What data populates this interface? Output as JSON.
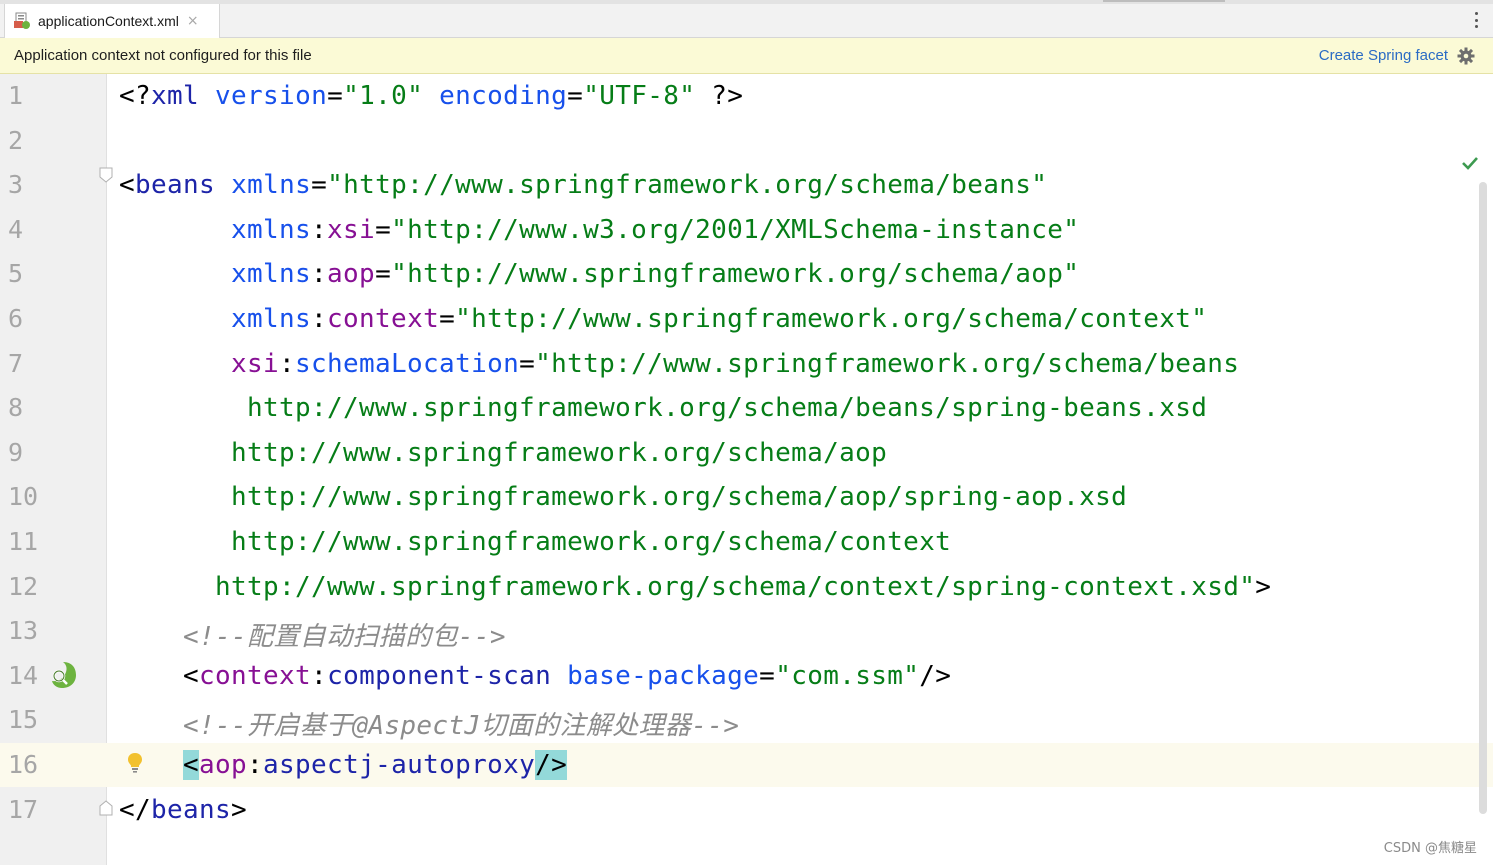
{
  "tab": {
    "label": "applicationContext.xml",
    "close": "×"
  },
  "banner": {
    "message": "Application context not configured for this file",
    "action": "Create Spring facet"
  },
  "lines": [
    {
      "number": "1",
      "indent": 0,
      "tokens": [
        {
          "t": "<?",
          "c": "punct"
        },
        {
          "t": "xml",
          "c": "tagname"
        },
        {
          "t": " ",
          "c": "punct"
        },
        {
          "t": "version",
          "c": "attr"
        },
        {
          "t": "=",
          "c": "punct"
        },
        {
          "t": "\"1.0\"",
          "c": "str"
        },
        {
          "t": " ",
          "c": "punct"
        },
        {
          "t": "encoding",
          "c": "attr"
        },
        {
          "t": "=",
          "c": "punct"
        },
        {
          "t": "\"UTF-8\"",
          "c": "str"
        },
        {
          "t": " ?>",
          "c": "punct"
        }
      ]
    },
    {
      "number": "2",
      "indent": 0,
      "tokens": []
    },
    {
      "number": "3",
      "indent": 0,
      "tokens": [
        {
          "t": "<",
          "c": "punct"
        },
        {
          "t": "beans",
          "c": "tagname"
        },
        {
          "t": " ",
          "c": "punct"
        },
        {
          "t": "xmlns",
          "c": "attr"
        },
        {
          "t": "=",
          "c": "punct"
        },
        {
          "t": "\"http://www.springframework.org/schema/beans\"",
          "c": "str"
        }
      ]
    },
    {
      "number": "4",
      "indent": 7,
      "tokens": [
        {
          "t": "xmlns",
          "c": "attr"
        },
        {
          "t": ":",
          "c": "punct"
        },
        {
          "t": "xsi",
          "c": "ns"
        },
        {
          "t": "=",
          "c": "punct"
        },
        {
          "t": "\"http://www.w3.org/2001/XMLSchema-instance\"",
          "c": "str"
        }
      ]
    },
    {
      "number": "5",
      "indent": 7,
      "tokens": [
        {
          "t": "xmlns",
          "c": "attr"
        },
        {
          "t": ":",
          "c": "punct"
        },
        {
          "t": "aop",
          "c": "ns"
        },
        {
          "t": "=",
          "c": "punct"
        },
        {
          "t": "\"http://www.springframework.org/schema/aop\"",
          "c": "str"
        }
      ]
    },
    {
      "number": "6",
      "indent": 7,
      "tokens": [
        {
          "t": "xmlns",
          "c": "attr"
        },
        {
          "t": ":",
          "c": "punct"
        },
        {
          "t": "context",
          "c": "ns"
        },
        {
          "t": "=",
          "c": "punct"
        },
        {
          "t": "\"http://www.springframework.org/schema/context\"",
          "c": "str"
        }
      ]
    },
    {
      "number": "7",
      "indent": 7,
      "tokens": [
        {
          "t": "xsi",
          "c": "ns"
        },
        {
          "t": ":",
          "c": "punct"
        },
        {
          "t": "schemaLocation",
          "c": "attr"
        },
        {
          "t": "=",
          "c": "punct"
        },
        {
          "t": "\"http://www.springframework.org/schema/beans",
          "c": "str"
        }
      ]
    },
    {
      "number": "8",
      "indent": 8,
      "tokens": [
        {
          "t": "http://www.springframework.org/schema/beans/spring-beans.xsd",
          "c": "str"
        }
      ]
    },
    {
      "number": "9",
      "indent": 7,
      "tokens": [
        {
          "t": "http://www.springframework.org/schema/aop",
          "c": "str"
        }
      ]
    },
    {
      "number": "10",
      "indent": 7,
      "tokens": [
        {
          "t": "http://www.springframework.org/schema/aop/spring-aop.xsd",
          "c": "str"
        }
      ]
    },
    {
      "number": "11",
      "indent": 7,
      "tokens": [
        {
          "t": "http://www.springframework.org/schema/context",
          "c": "str"
        }
      ]
    },
    {
      "number": "12",
      "indent": 6,
      "tokens": [
        {
          "t": "http://www.springframework.org/schema/context/spring-context.xsd\"",
          "c": "str"
        },
        {
          "t": ">",
          "c": "punct"
        }
      ]
    },
    {
      "number": "13",
      "indent": 4,
      "tokens": [
        {
          "t": "<!--配置自动扫描的包-->",
          "c": "cmt"
        }
      ]
    },
    {
      "number": "14",
      "indent": 4,
      "tokens": [
        {
          "t": "<",
          "c": "punct"
        },
        {
          "t": "context",
          "c": "ns"
        },
        {
          "t": ":",
          "c": "punct"
        },
        {
          "t": "component-scan",
          "c": "tagname"
        },
        {
          "t": " ",
          "c": "punct"
        },
        {
          "t": "base-package",
          "c": "attr"
        },
        {
          "t": "=",
          "c": "punct"
        },
        {
          "t": "\"com.ssm\"",
          "c": "str"
        },
        {
          "t": "/>",
          "c": "punct"
        }
      ]
    },
    {
      "number": "15",
      "indent": 4,
      "tokens": [
        {
          "t": "<!--开启基于@AspectJ切面的注解处理器-->",
          "c": "cmt"
        }
      ]
    },
    {
      "number": "16",
      "indent": 4,
      "current": true,
      "tokens": [
        {
          "t": "<",
          "c": "punct hl"
        },
        {
          "t": "aop",
          "c": "ns"
        },
        {
          "t": ":",
          "c": "punct"
        },
        {
          "t": "aspectj-autoproxy",
          "c": "tagname"
        },
        {
          "t": "/>",
          "c": "punct hl"
        }
      ]
    },
    {
      "number": "17",
      "indent": 0,
      "tokens": [
        {
          "t": "</",
          "c": "punct"
        },
        {
          "t": "beans",
          "c": "tagname"
        },
        {
          "t": ">",
          "c": "punct"
        }
      ]
    }
  ],
  "icons": {
    "tab_file": "spring-xml-file-icon",
    "banner_settings": "gear-icon",
    "inspection_status": "checkmark-icon",
    "gutter_spring": "spring-bean-search-icon",
    "intention": "lightbulb-icon",
    "fold": "fold-marker-icon"
  },
  "colors": {
    "tag": "#1d24a8",
    "namespace": "#871094",
    "attribute": "#1750eb",
    "string": "#067d17",
    "comment": "#8c8c8c",
    "brace_match": "#93d9d9",
    "banner": "#fbfad6",
    "current_line": "#fcfaed"
  },
  "watermark": "CSDN @焦糖星"
}
